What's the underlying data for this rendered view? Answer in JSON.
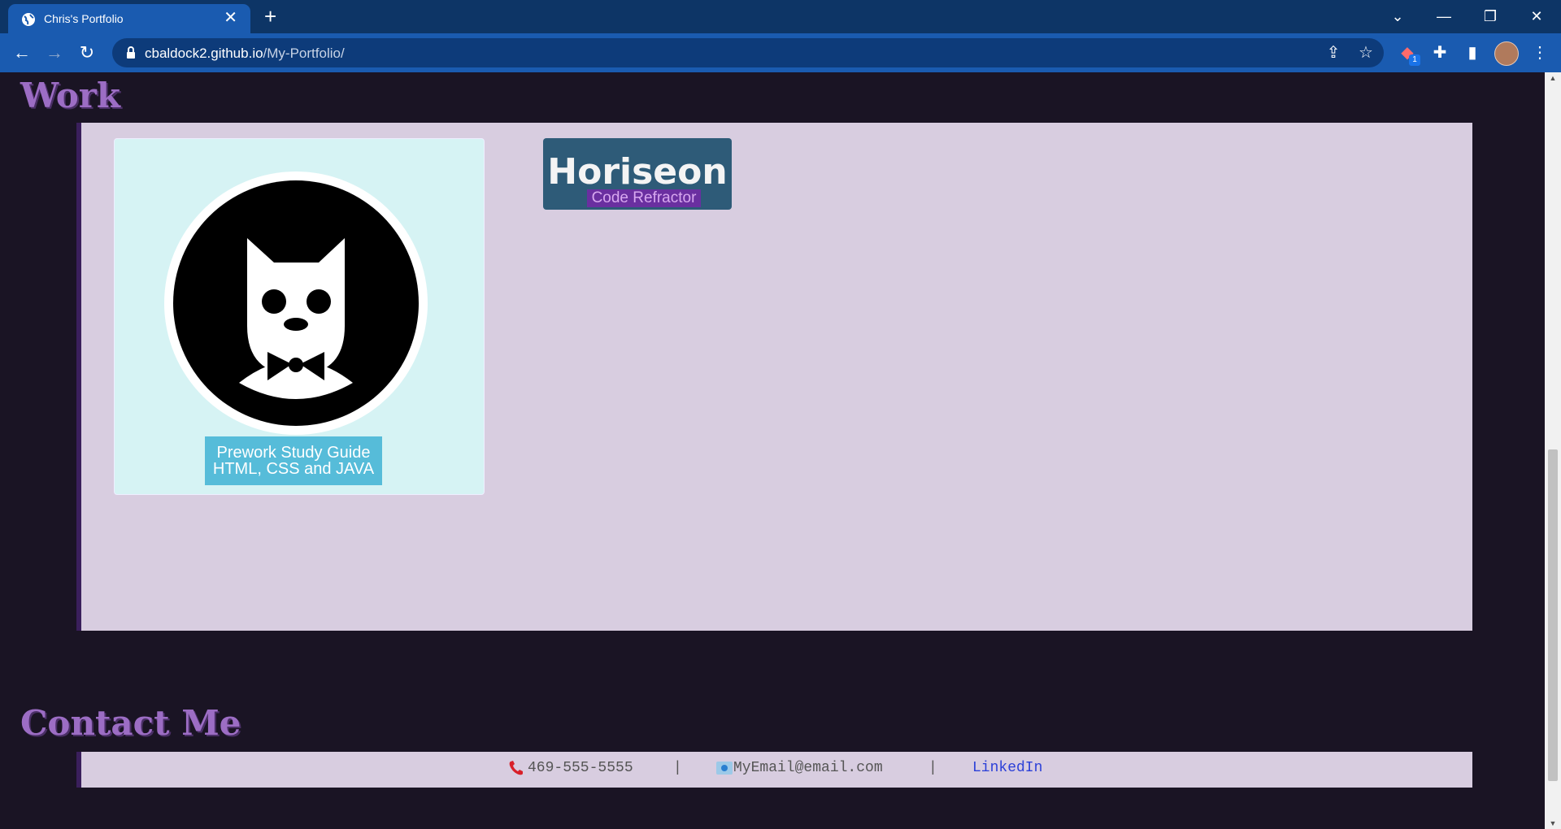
{
  "browser": {
    "tab_title": "Chris's Portfolio",
    "url_host": "cbaldock2.github.io",
    "url_path": "/My-Portfolio/",
    "extension_badge": "1"
  },
  "sections": {
    "work_title": "Work",
    "contact_title": "Contact Me"
  },
  "work": {
    "card1_caption_line1": "Prework Study Guide",
    "card1_caption_line2": "HTML, CSS and JAVA",
    "card2_brand": "Horiseon",
    "card2_sub": "Code Refractor"
  },
  "contact": {
    "phone": "469-555-5555",
    "separator": "|",
    "email": "MyEmail@email.com",
    "linkedin": "LinkedIn"
  },
  "colors": {
    "page_bg": "#1a1424",
    "panel_bg": "#d8cde0",
    "heading": "#9c6dc4",
    "chrome_tab": "#1a5bb0"
  }
}
